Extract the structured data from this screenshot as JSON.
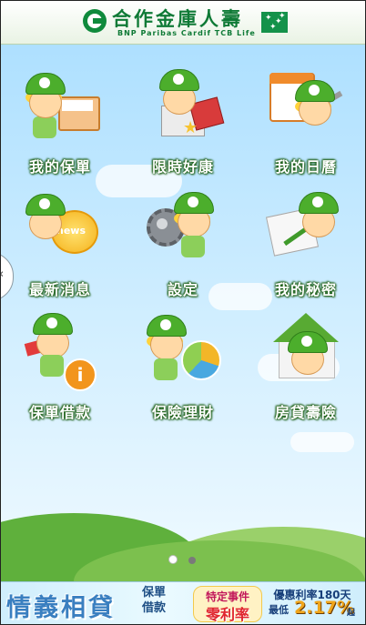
{
  "header": {
    "brand_cn": "合作金庫人壽",
    "brand_en": "BNP Paribas Cardif TCB Life"
  },
  "menu": {
    "items": [
      {
        "label": "我的保單",
        "icon": "policy-box-icon"
      },
      {
        "label": "限時好康",
        "icon": "gift-box-icon"
      },
      {
        "label": "我的日曆",
        "icon": "calendar-icon"
      },
      {
        "label": "最新消息",
        "icon": "news-icon"
      },
      {
        "label": "設定",
        "icon": "gear-icon"
      },
      {
        "label": "我的秘密",
        "icon": "note-pencil-icon"
      },
      {
        "label": "保單借款",
        "icon": "info-loan-icon"
      },
      {
        "label": "保險理財",
        "icon": "pie-chart-icon"
      },
      {
        "label": "房貸壽險",
        "icon": "house-icon"
      }
    ]
  },
  "side_tab": {
    "glyph": "‹"
  },
  "pager": {
    "pages": 2,
    "active_index": 0
  },
  "banner": {
    "title": "情義相貸",
    "sub1": "保單",
    "sub2": "借款",
    "badge1_line1": "特定事件",
    "badge1_line2": "零利率",
    "badge2_line1": "優惠利率180天",
    "badge2_prefix": "最低",
    "badge2_rate": "2.17%",
    "badge2_suffix": "起"
  },
  "colors": {
    "brand_green": "#0f7a36",
    "label_outline": "#1d5f16",
    "sky_top": "#aee0ff",
    "banner_blue": "#3a7fc0"
  }
}
